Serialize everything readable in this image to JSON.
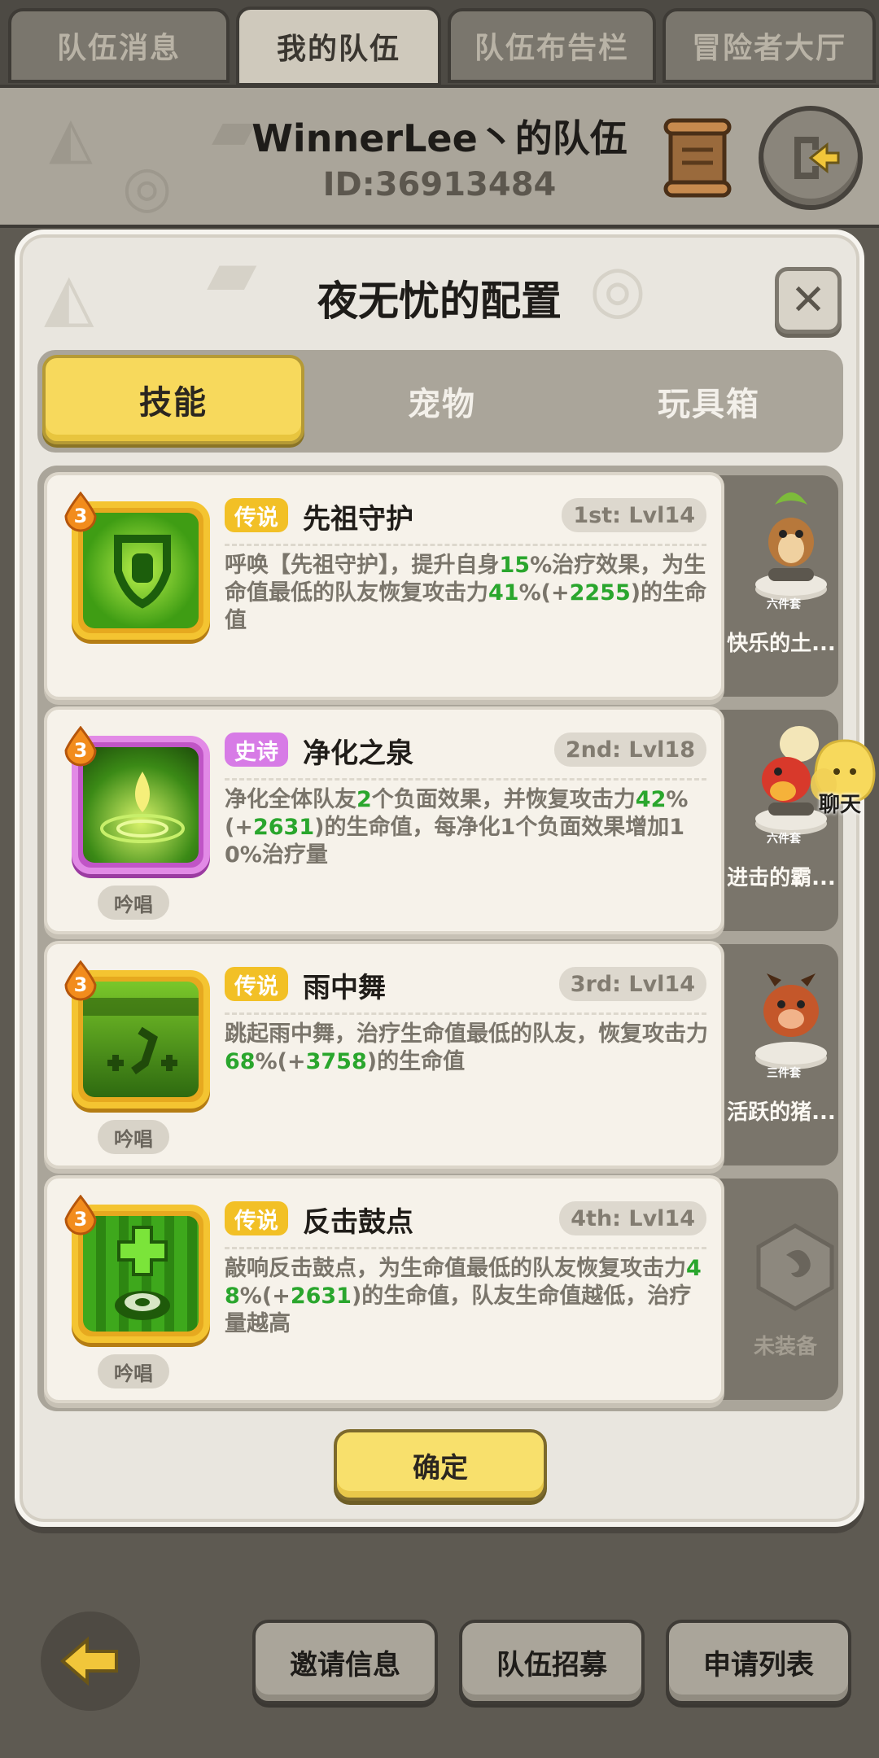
{
  "top_tabs": [
    {
      "label": "队伍消息"
    },
    {
      "label": "我的队伍"
    },
    {
      "label": "队伍布告栏"
    },
    {
      "label": "冒险者大厅"
    }
  ],
  "team": {
    "title": "WinnerLee丶的队伍",
    "id": "ID:36913484"
  },
  "dialog": {
    "title": "夜无忧的配置",
    "tabs": [
      {
        "label": "技能"
      },
      {
        "label": "宠物"
      },
      {
        "label": "玩具箱"
      }
    ],
    "confirm_label": "确定"
  },
  "skills": [
    {
      "badge": "3",
      "rarity": "传说",
      "name": "先祖守护",
      "slot": "1st: Lvl14",
      "cast": "",
      "desc": [
        {
          "t": "呼唤【先祖守护】，提升自身"
        },
        {
          "t": "15",
          "g": true
        },
        {
          "t": "%治疗效果，为生命值最低的队友恢复攻击力"
        },
        {
          "t": "41",
          "g": true
        },
        {
          "t": "%(+"
        },
        {
          "t": "2255",
          "g": true
        },
        {
          "t": ")的生命值"
        }
      ],
      "pet": {
        "set": "六件套",
        "name": "快乐的土..."
      }
    },
    {
      "badge": "3",
      "rarity": "史诗",
      "name": "净化之泉",
      "slot": "2nd: Lvl18",
      "cast": "吟唱",
      "desc": [
        {
          "t": "净化全体队友"
        },
        {
          "t": "2",
          "g": true
        },
        {
          "t": "个负面效果，并恢复攻击力"
        },
        {
          "t": "42",
          "g": true
        },
        {
          "t": "%(+"
        },
        {
          "t": "2631",
          "g": true
        },
        {
          "t": ")的生命值，每净化1个负面效果增加10%治疗量"
        }
      ],
      "pet": {
        "set": "六件套",
        "name": "进击的霸..."
      }
    },
    {
      "badge": "3",
      "rarity": "传说",
      "name": "雨中舞",
      "slot": "3rd: Lvl14",
      "cast": "吟唱",
      "desc": [
        {
          "t": "跳起雨中舞，治疗生命值最低的队友，恢复攻击力"
        },
        {
          "t": "68",
          "g": true
        },
        {
          "t": "%(+"
        },
        {
          "t": "3758",
          "g": true
        },
        {
          "t": ")的生命值"
        }
      ],
      "pet": {
        "set": "三件套",
        "name": "活跃的猪..."
      }
    },
    {
      "badge": "3",
      "rarity": "传说",
      "name": "反击鼓点",
      "slot": "4th: Lvl14",
      "cast": "吟唱",
      "desc": [
        {
          "t": "敲响反击鼓点，为生命值最低的队友恢复攻击力"
        },
        {
          "t": "48",
          "g": true
        },
        {
          "t": "%(+"
        },
        {
          "t": "2631",
          "g": true
        },
        {
          "t": ")的生命值，队友生命值越低，治疗量越高"
        }
      ],
      "pet": {
        "set": "",
        "name": "未装备"
      }
    }
  ],
  "chat": {
    "label": "聊天"
  },
  "bottom": [
    {
      "label": "邀请信息"
    },
    {
      "label": "队伍招募"
    },
    {
      "label": "申请列表"
    }
  ],
  "colors": {
    "accent_yellow": "#f7d95c",
    "legend": "#f2c026",
    "epic": "#d77be6",
    "highlight_green": "#2aa62d"
  }
}
